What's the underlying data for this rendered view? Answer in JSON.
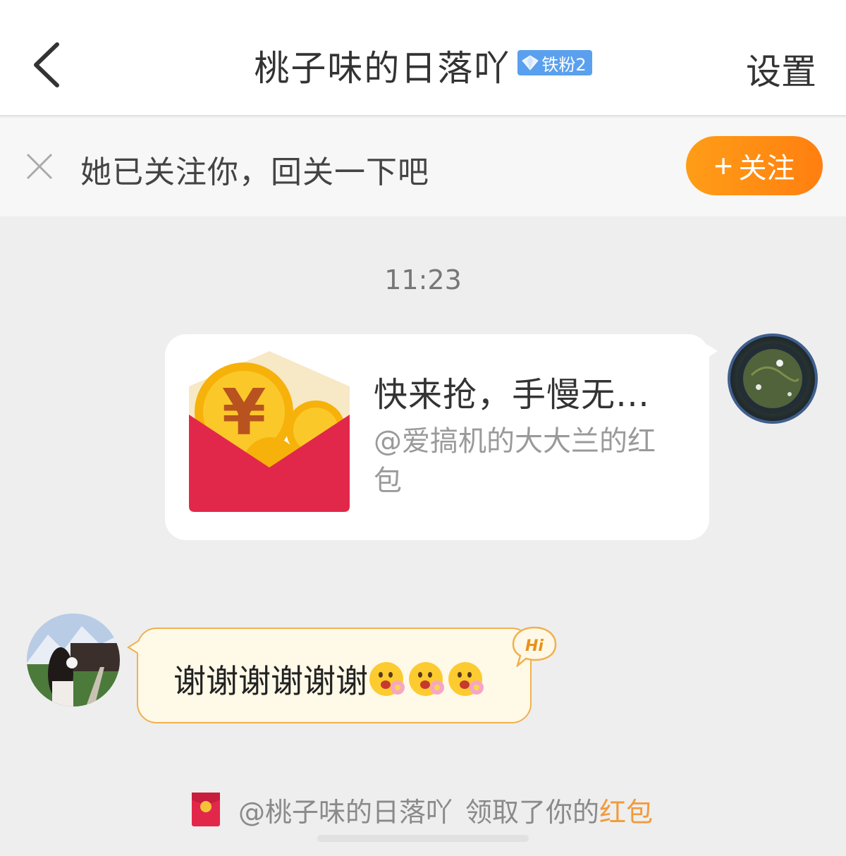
{
  "header": {
    "title": "桃子味的日落吖",
    "fan_badge": "铁粉2",
    "settings_label": "设置"
  },
  "follow_banner": {
    "text": "她已关注你，回关一下吧",
    "button_label": "关注"
  },
  "chat": {
    "timestamp": "11:23",
    "red_packet": {
      "title": "快来抢，手慢无…",
      "subtitle": "@爱搞机的大大兰的红包"
    },
    "reply": {
      "text": "谢谢谢谢谢谢",
      "emoji_count": 3,
      "badge": "Hi"
    },
    "notice": {
      "mention": "@桃子味的日落吖",
      "verb": "领取了你的",
      "link": "红包"
    }
  },
  "colors": {
    "accent_orange": "#ff8a14",
    "fan_badge_blue": "#5aa0ee",
    "red_packet_red": "#e2284a",
    "link_orange": "#f29a3a"
  }
}
